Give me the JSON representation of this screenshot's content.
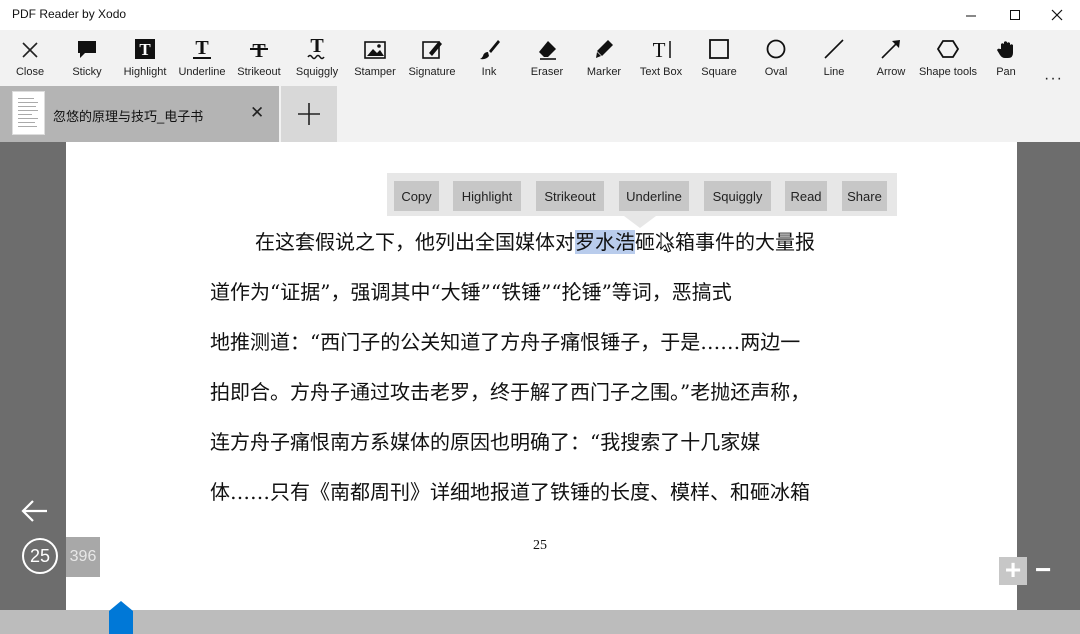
{
  "window": {
    "title": "PDF Reader by Xodo"
  },
  "toolbar": {
    "tools": [
      {
        "label": "Close",
        "icon": "close-icon"
      },
      {
        "label": "Sticky",
        "icon": "sticky-note-icon"
      },
      {
        "label": "Highlight",
        "icon": "highlight-icon"
      },
      {
        "label": "Underline",
        "icon": "underline-icon"
      },
      {
        "label": "Strikeout",
        "icon": "strikeout-icon"
      },
      {
        "label": "Squiggly",
        "icon": "squiggly-icon"
      },
      {
        "label": "Stamper",
        "icon": "image-icon"
      },
      {
        "label": "Signature",
        "icon": "signature-icon"
      },
      {
        "label": "Ink",
        "icon": "brush-icon"
      },
      {
        "label": "Eraser",
        "icon": "eraser-icon"
      },
      {
        "label": "Marker",
        "icon": "marker-icon"
      },
      {
        "label": "Text Box",
        "icon": "text-box-icon"
      },
      {
        "label": "Square",
        "icon": "square-icon"
      },
      {
        "label": "Oval",
        "icon": "oval-icon"
      },
      {
        "label": "Line",
        "icon": "line-icon"
      },
      {
        "label": "Arrow",
        "icon": "arrow-icon"
      },
      {
        "label": "Shape tools",
        "icon": "hexagon-icon"
      },
      {
        "label": "Pan",
        "icon": "hand-icon"
      }
    ],
    "more": "···"
  },
  "tabs": [
    {
      "title": "忽悠的原理与技巧_电子书",
      "close": "✕"
    }
  ],
  "new_tab": "+",
  "context_menu": [
    "Copy",
    "Highlight",
    "Strikeout",
    "Underline",
    "Squiggly",
    "Read",
    "Share"
  ],
  "document": {
    "line1_before": "在这套假说之下，他列出全国媒体对",
    "line1_selected": "罗水浩",
    "line1_after": "砸冰箱事件的大量报",
    "lines": [
      "道作为“证据”，强调其中“大锤”“铁锤”“抡锤”等词，恶搞式",
      "地推测道：“西门子的公关知道了方舟子痛恨锤子，于是……两边一",
      "拍即合。方舟子通过攻击老罗，终于解了西门子之围。”老抛还声称，",
      "连方舟子痛恨南方系媒体的原因也明确了：“我搜索了十几家媒",
      "体……只有《南都周刊》详细地报道了铁锤的长度、模样、和砸冰箱"
    ],
    "page_number_printed": "25"
  },
  "navigation": {
    "current_page": "25",
    "total_pages": "396",
    "zoom_in": "+",
    "zoom_out": "−",
    "scrub_position_fraction": 0.063
  },
  "colors": {
    "selection": "#b9ccec",
    "accent": "#0078d7",
    "viewer_background": "#6d6d6d"
  }
}
